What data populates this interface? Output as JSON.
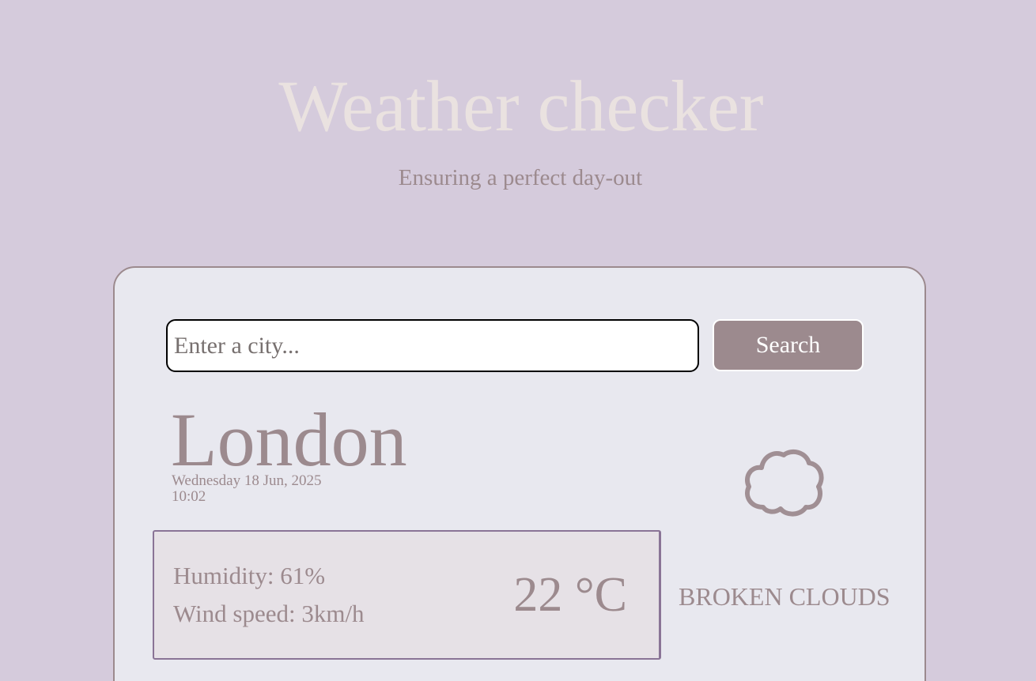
{
  "header": {
    "title": "Weather checker",
    "subtitle": "Ensuring a perfect day-out"
  },
  "search": {
    "placeholder": "Enter a city...",
    "value": "",
    "button_label": "Search"
  },
  "weather": {
    "city": "London",
    "date": "Wednesday 18 Jun, 2025",
    "time": "10:02",
    "humidity": "Humidity: 61%",
    "wind": "Wind speed: 3km/h",
    "temperature": "22 °C",
    "condition": "BROKEN CLOUDS",
    "icon": "cloud-icon"
  },
  "colors": {
    "background": "#d5cbdc",
    "card": "#e8e8ef",
    "accent": "#9c8a8e",
    "title": "#eae2e0"
  }
}
